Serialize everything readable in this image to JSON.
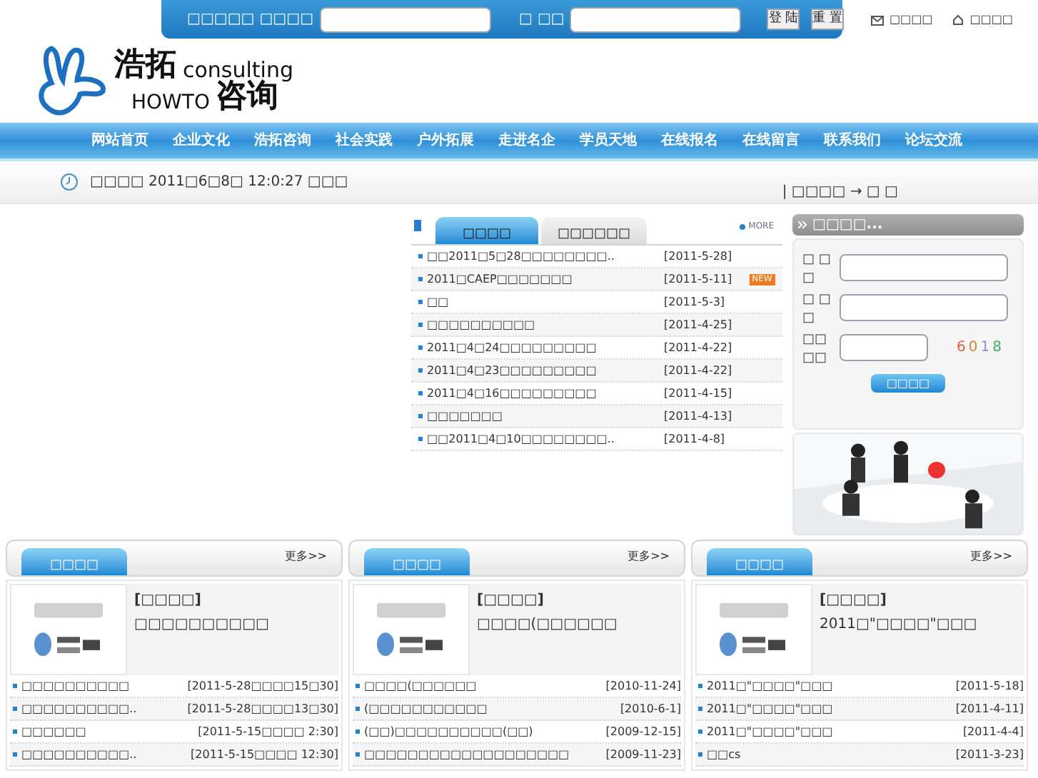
{
  "top_login": {
    "username_label": "□□□□□ □□□□",
    "password_label": "□ □□",
    "buttons": [
      "登 陆",
      "重 置"
    ],
    "links": [
      {
        "kind": "mail",
        "label": "□□□□"
      },
      {
        "kind": "home",
        "label": "□□□□"
      }
    ]
  },
  "logo": {
    "cn_top": "浩拓",
    "en_top": "consulting",
    "en_bottom": "HOWTO",
    "cn_bottom": "咨询"
  },
  "nav": {
    "items": [
      {
        "label": "网站首页"
      },
      {
        "label": "企业文化"
      },
      {
        "label": "浩拓咨询"
      },
      {
        "label": "社会实践"
      },
      {
        "label": "户外拓展"
      },
      {
        "label": "走进名企"
      },
      {
        "label": "学员天地"
      },
      {
        "label": "在线报名"
      },
      {
        "label": "在线留言"
      },
      {
        "label": "联系我们"
      },
      {
        "label": "论坛交流"
      }
    ]
  },
  "date_bar": {
    "text": "□□□□ 2011□6□8□ 12:0:27 □□□",
    "location": "| □□□□ → □ □"
  },
  "news": {
    "tabs": [
      {
        "label": "□□□□",
        "selected": true
      },
      {
        "label": "□□□□□□",
        "selected": false
      }
    ],
    "more": "MORE",
    "items": [
      {
        "title": "□□2011□5□28□□□□□□□□..",
        "date": "[2011-5-28]",
        "new": false
      },
      {
        "title": "2011□CAEP□□□□□□□",
        "date": "[2011-5-11]",
        "new": true
      },
      {
        "title": "□□",
        "date": "[2011-5-3]",
        "new": false
      },
      {
        "title": "□□□□□□□□□□",
        "date": "[2011-4-25]",
        "new": false
      },
      {
        "title": "2011□4□24□□□□□□□□□",
        "date": "[2011-4-22]",
        "new": false
      },
      {
        "title": "2011□4□23□□□□□□□□□",
        "date": "[2011-4-22]",
        "new": false
      },
      {
        "title": "2011□4□16□□□□□□□□□",
        "date": "[2011-4-15]",
        "new": false
      },
      {
        "title": "□□□□□□□",
        "date": "[2011-4-13]",
        "new": false
      },
      {
        "title": "□□2011□4□10□□□□□□□□..",
        "date": "[2011-4-8]",
        "new": false
      }
    ],
    "new_badge": "NEW"
  },
  "member_login": {
    "title": "□□□□...",
    "fields": [
      {
        "label": "□ □ □",
        "kind": "text"
      },
      {
        "label": "□ □ □",
        "kind": "password"
      },
      {
        "label": "□□□□",
        "kind": "captcha"
      }
    ],
    "captcha": "6018",
    "submit": "□□□□"
  },
  "columns": [
    {
      "title": "□□□□",
      "more": "更多>>",
      "feature_tag": "[□□□□]",
      "feature_title": "□□□□□□□□□□",
      "items": [
        {
          "title": "□□□□□□□□□□",
          "date": "[2011-5-28□□□□15□30]"
        },
        {
          "title": "□□□□□□□□□□..",
          "date": "[2011-5-28□□□□13□30]"
        },
        {
          "title": "□□□□□□",
          "date": "[2011-5-15□□□□ 2:30]"
        },
        {
          "title": "□□□□□□□□□□..",
          "date": "[2011-5-15□□□□ 12:30]"
        }
      ]
    },
    {
      "title": "□□□□",
      "more": "更多>>",
      "feature_tag": "[□□□□]",
      "feature_title": "□□□□(□□□□□□",
      "items": [
        {
          "title": "□□□□(□□□□□□",
          "date": "[2010-11-24]"
        },
        {
          "title": "(□□□□□□□□□□□",
          "date": "[2010-6-1]"
        },
        {
          "title": "(□□)□□□□□□□□□□(□□)",
          "date": "[2009-12-15]"
        },
        {
          "title": "□□□□□□□□□□□□□□□□□□□",
          "date": "[2009-11-23]"
        }
      ]
    },
    {
      "title": "□□□□",
      "more": "更多>>",
      "feature_tag": "[□□□□]",
      "feature_title": "2011□\"□□□□\"□□□",
      "items": [
        {
          "title": "2011□\"□□□□\"□□□",
          "date": "[2011-5-18]"
        },
        {
          "title": "2011□\"□□□□\"□□□",
          "date": "[2011-4-11]"
        },
        {
          "title": "2011□\"□□□□\"□□□",
          "date": "[2011-4-4]"
        },
        {
          "title": "□□cs",
          "date": "[2011-3-23]"
        }
      ]
    }
  ]
}
